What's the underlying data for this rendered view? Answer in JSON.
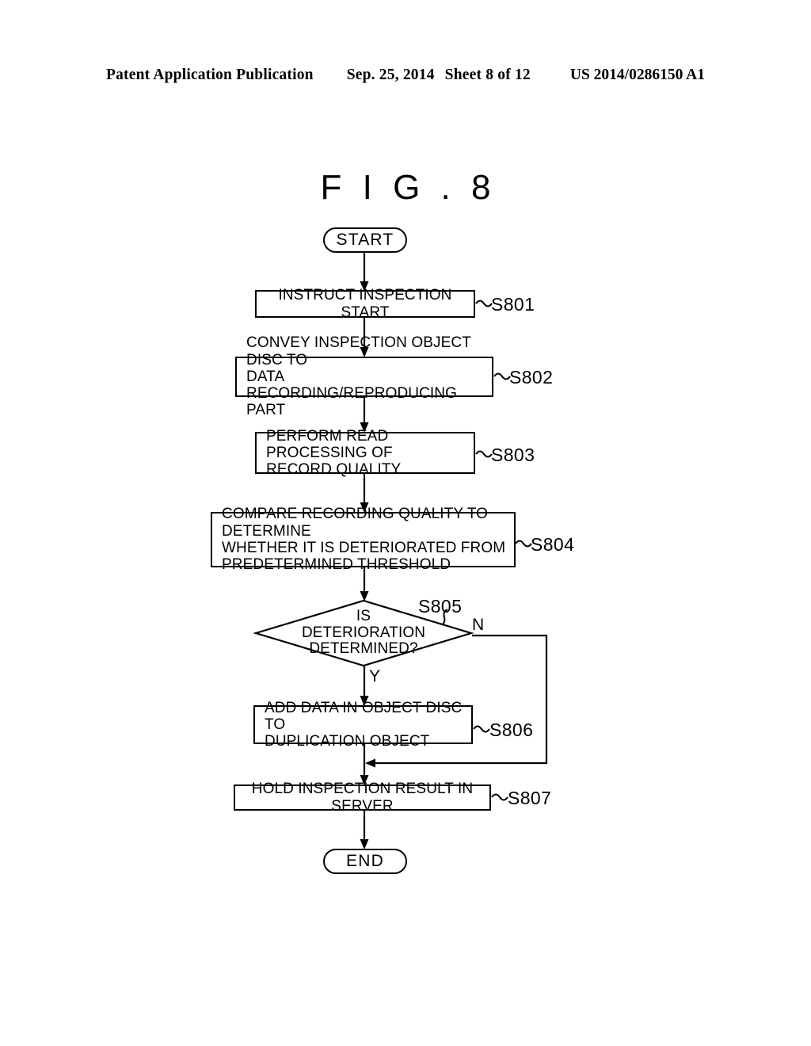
{
  "header": {
    "publication": "Patent Application Publication",
    "date": "Sep. 25, 2014",
    "sheet": "Sheet 8 of 12",
    "patent_number": "US 2014/0286150 A1"
  },
  "figure": {
    "title": "F I G . 8"
  },
  "flowchart": {
    "start_label": "START",
    "end_label": "END",
    "branch_yes": "Y",
    "branch_no": "N",
    "steps": [
      {
        "id": "S801",
        "text": "INSTRUCT INSPECTION START"
      },
      {
        "id": "S802",
        "text": "CONVEY INSPECTION OBJECT DISC TO\nDATA RECORDING/REPRODUCING PART"
      },
      {
        "id": "S803",
        "text": "PERFORM READ PROCESSING OF\nRECORD QUALITY"
      },
      {
        "id": "S804",
        "text": "COMPARE RECORDING QUALITY TO DETERMINE\nWHETHER IT IS DETERIORATED FROM\nPREDETERMINED THRESHOLD"
      },
      {
        "id": "S805",
        "text": "IS\nDETERIORATION\nDETERMINED?"
      },
      {
        "id": "S806",
        "text": "ADD DATA IN OBJECT DISC TO\nDUPLICATION OBJECT"
      },
      {
        "id": "S807",
        "text": "HOLD INSPECTION RESULT IN SERVER"
      }
    ]
  },
  "colors": {
    "ink": "#000000",
    "paper": "#ffffff"
  }
}
